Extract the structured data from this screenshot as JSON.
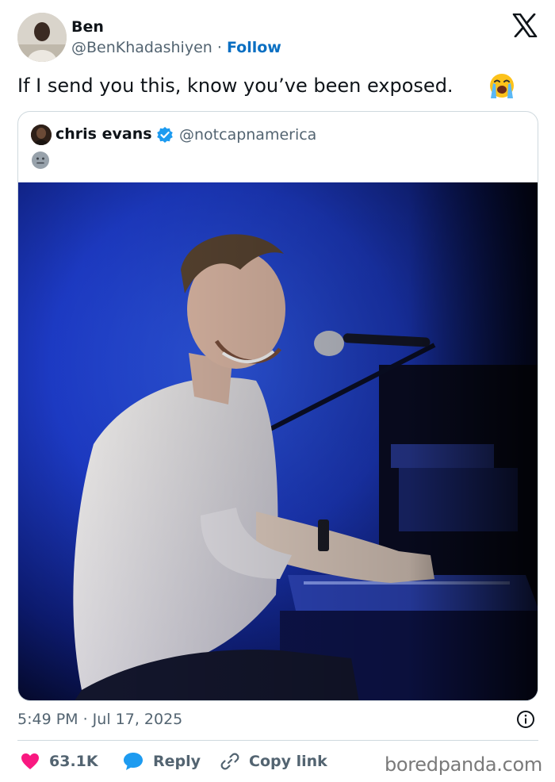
{
  "author": {
    "name": "Ben",
    "handle": "@BenKhadashiyen",
    "separator": " · ",
    "follow_label": "Follow"
  },
  "platform_icon": "x-logo-icon",
  "tweet": {
    "text": "If I send you this, know you’ve been exposed.",
    "emoji": "loudly-crying-face-emoji"
  },
  "quoted": {
    "name": "chris evans",
    "verified": true,
    "handle": "@notcapnamerica",
    "emoji": "neutral-face-emoji",
    "image": "photo-man-smiling-at-piano-blue-stage-light"
  },
  "meta": {
    "timestamp": "5:49 PM · Jul 17, 2025"
  },
  "actions": {
    "likes": "63.1K",
    "reply": "Reply",
    "copy_link": "Copy link"
  },
  "watermark": "boredpanda.com",
  "colors": {
    "link": "#0a6fc2",
    "like": "#f91880",
    "reply": "#1d9bf0",
    "verified": "#1d9bf0",
    "muted": "#536471"
  }
}
